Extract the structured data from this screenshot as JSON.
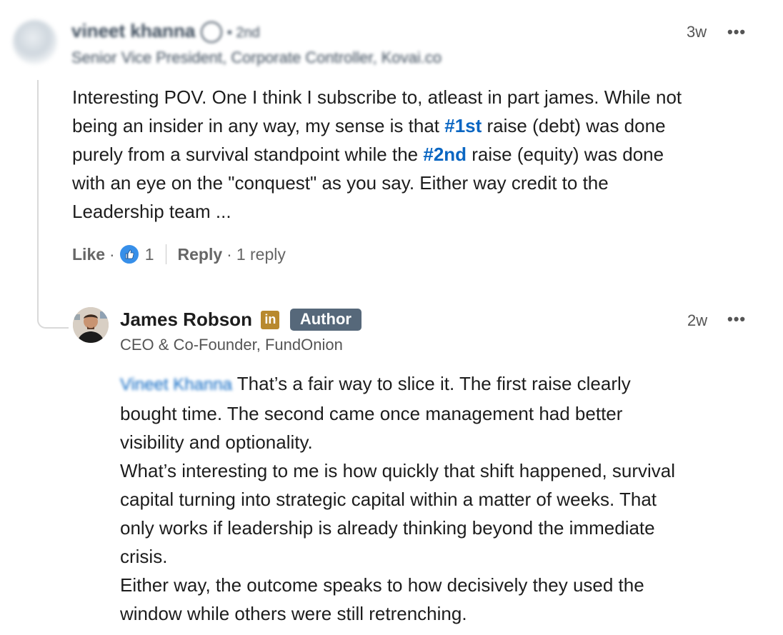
{
  "comment": {
    "author_name": "vineet khanna",
    "degree": "• 2nd",
    "headline": "Senior Vice President, Corporate Controller, Kovai.co",
    "time": "3w",
    "more_label": "•••",
    "body_lines": [
      [
        "Interesting POV. One I think I subscribe to, atleast in part james. While not"
      ],
      [
        "being an insider in any way, my sense is that ",
        "#1st",
        " raise (debt) was done"
      ],
      [
        "purely from a survival standpoint while the ",
        "#2nd",
        " raise (equity) was done"
      ],
      [
        "with an eye on the \"conquest\" as you say. Either way credit to the"
      ],
      [
        "Leadership team ..."
      ]
    ],
    "actions": {
      "like": "Like",
      "dot": "·",
      "reaction_count": "1",
      "reply": "Reply",
      "replies": "1 reply"
    },
    "icons": {
      "verified": "verified-shield-icon",
      "reaction": "thumbs-up-icon"
    }
  },
  "reply": {
    "author_name": "James Robson",
    "linkedin_badge": "in",
    "author_badge": "Author",
    "headline": "CEO & Co-Founder, FundOnion",
    "time": "2w",
    "more_label": "•••",
    "mention": "Vineet Khanna",
    "body_lines": [
      " That’s a fair way to slice it. The first raise clearly",
      "bought time. The second came once management had better",
      "visibility and optionality.",
      "What’s interesting to me is how quickly that shift happened, survival",
      "capital turning into strategic capital within a matter of weeks. That",
      "only works if leadership is already thinking beyond the immediate",
      "crisis.",
      "Either way, the outcome speaks to how decisively they used the",
      "window while others were still retrenching."
    ]
  },
  "colors": {
    "hashtag": "#0a66c2",
    "reaction": "#378fe9",
    "author_badge_bg": "#56687a",
    "linkedin_badge_bg": "#b8892e"
  }
}
